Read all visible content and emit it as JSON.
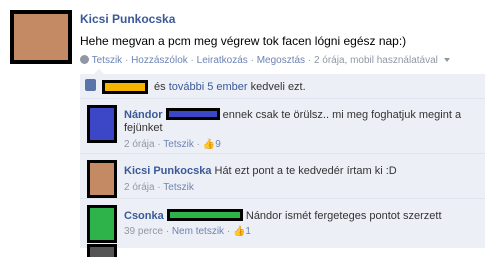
{
  "post": {
    "author": "Kicsi Punkocska",
    "text": "Hehe megvan a pcm meg végrew tok facen lógni egész nap:)",
    "meta": {
      "like": "Tetszik",
      "comments": "Hozzászólok",
      "tag": "Leiratkozás",
      "share": "Megosztás",
      "time": "2 órája, mobil használatával"
    }
  },
  "likes": {
    "text_prefix": "és",
    "others_link": "további 5 ember",
    "text_suffix": "kedveli ezt."
  },
  "comments": [
    {
      "author": "Nándor",
      "text_line1": "ennek csak te örülsz.. mi meg foghatjuk megint a",
      "text_line2": "fejünket",
      "time": "2 órája",
      "like": "Tetszik",
      "like_count": "9",
      "avatar_color": "#3b47c6"
    },
    {
      "author": "Kicsi Punkocska",
      "text": "Hát ezt pont a te kedvedér írtam ki :D",
      "time": "2 órája",
      "like": "Tetszik",
      "avatar_color": "#c38a64"
    },
    {
      "author": "Csonka",
      "text": "Nándor ismét fergeteges pontot szerzett",
      "time": "39 perce",
      "like": "Nem tetszik",
      "like_count": "1",
      "avatar_color": "#2db34a"
    }
  ],
  "colors": {
    "link": "#3b5998",
    "likes_redact": "#f4b400",
    "nandor_redact": "#3b47c6",
    "csonka_redact": "#2db34a"
  }
}
